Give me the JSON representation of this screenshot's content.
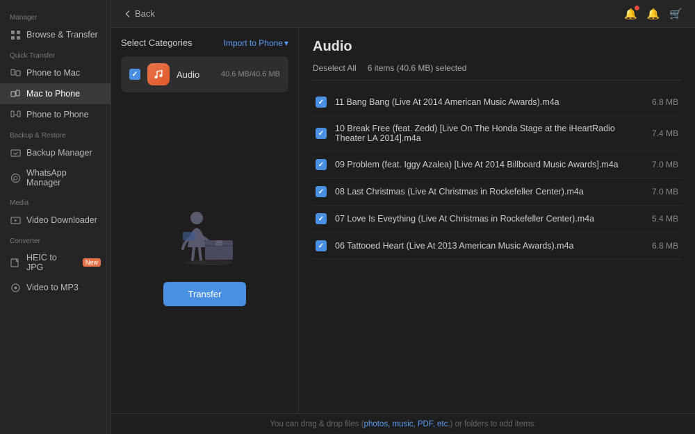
{
  "sidebar": {
    "manager_label": "Manager",
    "quick_transfer_label": "Quick Transfer",
    "backup_restore_label": "Backup & Restore",
    "media_label": "Media",
    "converter_label": "Converter",
    "items": {
      "browse_transfer": "Browse & Transfer",
      "phone_to_mac": "Phone to Mac",
      "mac_to_phone": "Mac to Phone",
      "phone_to_phone": "Phone to Phone",
      "backup_manager": "Backup Manager",
      "whatsapp_manager": "WhatsApp Manager",
      "video_downloader": "Video Downloader",
      "heic_to_jpg": "HEIC to JPG",
      "video_to_mp3": "Video to MP3",
      "new_badge": "New"
    }
  },
  "header": {
    "back_label": "Back"
  },
  "categories": {
    "title": "Select Categories",
    "import_btn": "Import to Phone",
    "audio_name": "Audio",
    "audio_size": "40.6 MB/40.6 MB"
  },
  "transfer": {
    "btn_label": "Transfer"
  },
  "audio": {
    "title": "Audio",
    "deselect_btn": "Deselect All",
    "selection_info": "6 items (40.6 MB) selected",
    "files": [
      {
        "name": "11 Bang Bang (Live At 2014 American Music Awards).m4a",
        "size": "6.8 MB"
      },
      {
        "name": "10 Break Free (feat. Zedd) [Live On The Honda Stage at the iHeartRadio Theater LA 2014].m4a",
        "size": "7.4 MB"
      },
      {
        "name": "09 Problem (feat. Iggy Azalea)  [Live At 2014 Billboard Music Awards].m4a",
        "size": "7.0 MB"
      },
      {
        "name": "08 Last Christmas  (Live At Christmas in Rockefeller Center).m4a",
        "size": "7.0 MB"
      },
      {
        "name": "07 Love Is Eveything (Live At Christmas in Rockefeller Center).m4a",
        "size": "5.4 MB"
      },
      {
        "name": "06 Tattooed Heart  (Live At 2013 American Music Awards).m4a",
        "size": "6.8 MB"
      }
    ]
  },
  "bottom_bar": {
    "text_before": "You can drag & drop files (",
    "link_text": "photos, music, PDF, etc.",
    "text_after": ") or folders to add items."
  }
}
